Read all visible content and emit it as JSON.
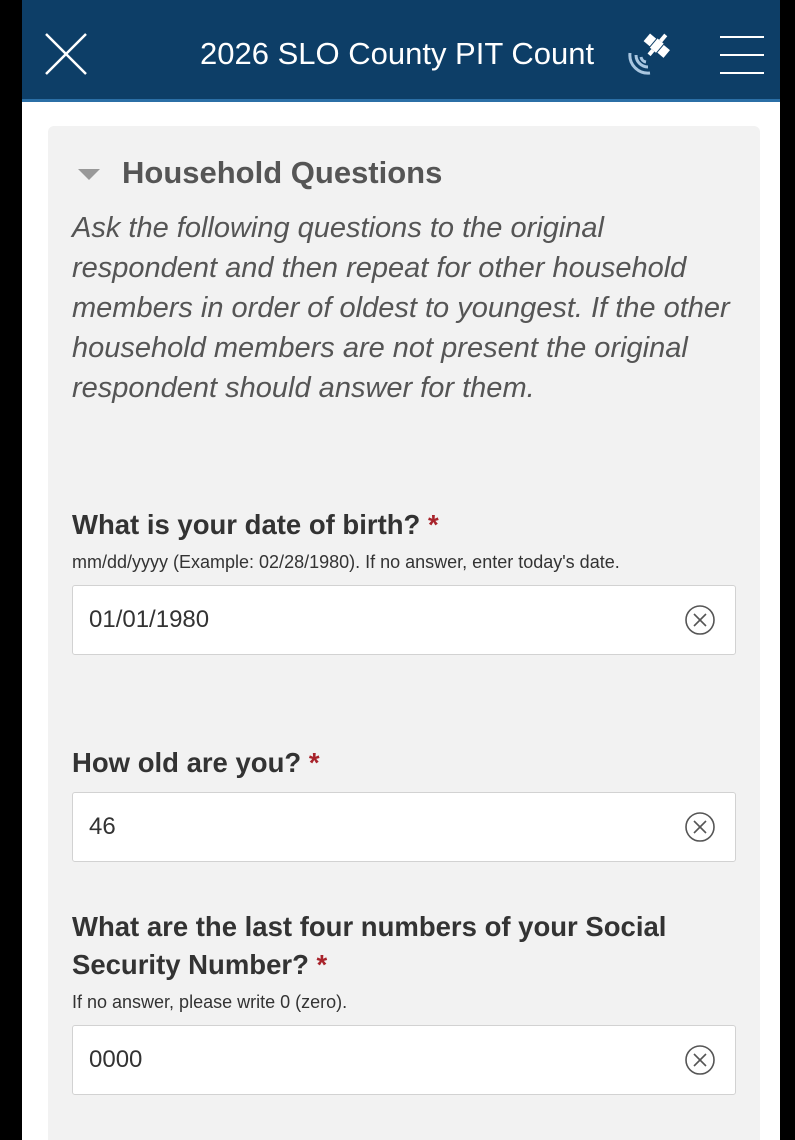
{
  "header": {
    "title": "2026 SLO County PIT Count",
    "close_icon": "close-icon",
    "gps_icon": "satellite-gps-icon",
    "menu_icon": "hamburger-menu-icon",
    "background": "#0d3e67"
  },
  "section": {
    "title": "Household Questions",
    "intro": "Ask the following questions to the original respondent and then repeat for other household members in order of oldest to youngest. If the other household members are not present the original respondent should answer for them."
  },
  "questions": [
    {
      "label": "What is your date of birth?",
      "required_marker": "*",
      "hint": "mm/dd/yyyy (Example: 02/28/1980). If no answer, enter today's date.",
      "value": "01/01/1980"
    },
    {
      "label": "How old are you?",
      "required_marker": "*",
      "value": "46"
    },
    {
      "label": "What are the last four numbers of your Social Security Number?",
      "required_marker": "*",
      "hint": "If no answer, please write 0 (zero).",
      "value": "0000"
    }
  ],
  "colors": {
    "header": "#0d3e67",
    "required": "#a8232b",
    "card": "#f2f2f2"
  }
}
